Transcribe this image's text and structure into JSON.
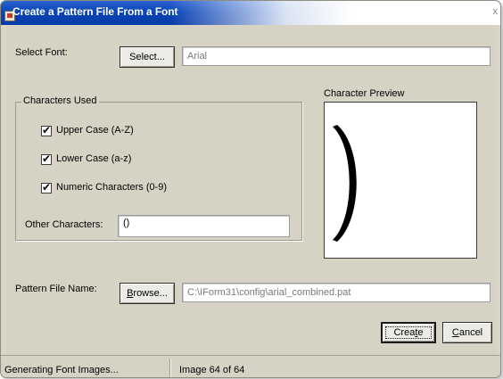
{
  "window": {
    "title": "Create a Pattern File From a Font",
    "close_glyph": "x"
  },
  "select_font": {
    "label": "Select Font:",
    "button_label": "Select...",
    "value": "Arial"
  },
  "characters_used": {
    "legend": "Characters Used",
    "checkboxes": [
      {
        "label": "Upper Case (A-Z)",
        "checked": true
      },
      {
        "label": "Lower Case (a-z)",
        "checked": true
      },
      {
        "label": "Numeric Characters (0-9)",
        "checked": true
      }
    ],
    "other_label": "Other Characters:",
    "other_value": "()"
  },
  "preview": {
    "label": "Character Preview",
    "glyph": ")"
  },
  "pattern_file": {
    "label": "Pattern File Name:",
    "browse_underline": "B",
    "browse_rest": "rowse...",
    "value": "C:\\IForm31\\config\\arial_combined.pat"
  },
  "actions": {
    "create_pre": "Crea",
    "create_underline": "t",
    "create_post": "e",
    "cancel_underline": "C",
    "cancel_rest": "ancel"
  },
  "status": {
    "left": "Generating Font Images...",
    "right": "Image 64 of 64"
  },
  "check_mark": "✔"
}
